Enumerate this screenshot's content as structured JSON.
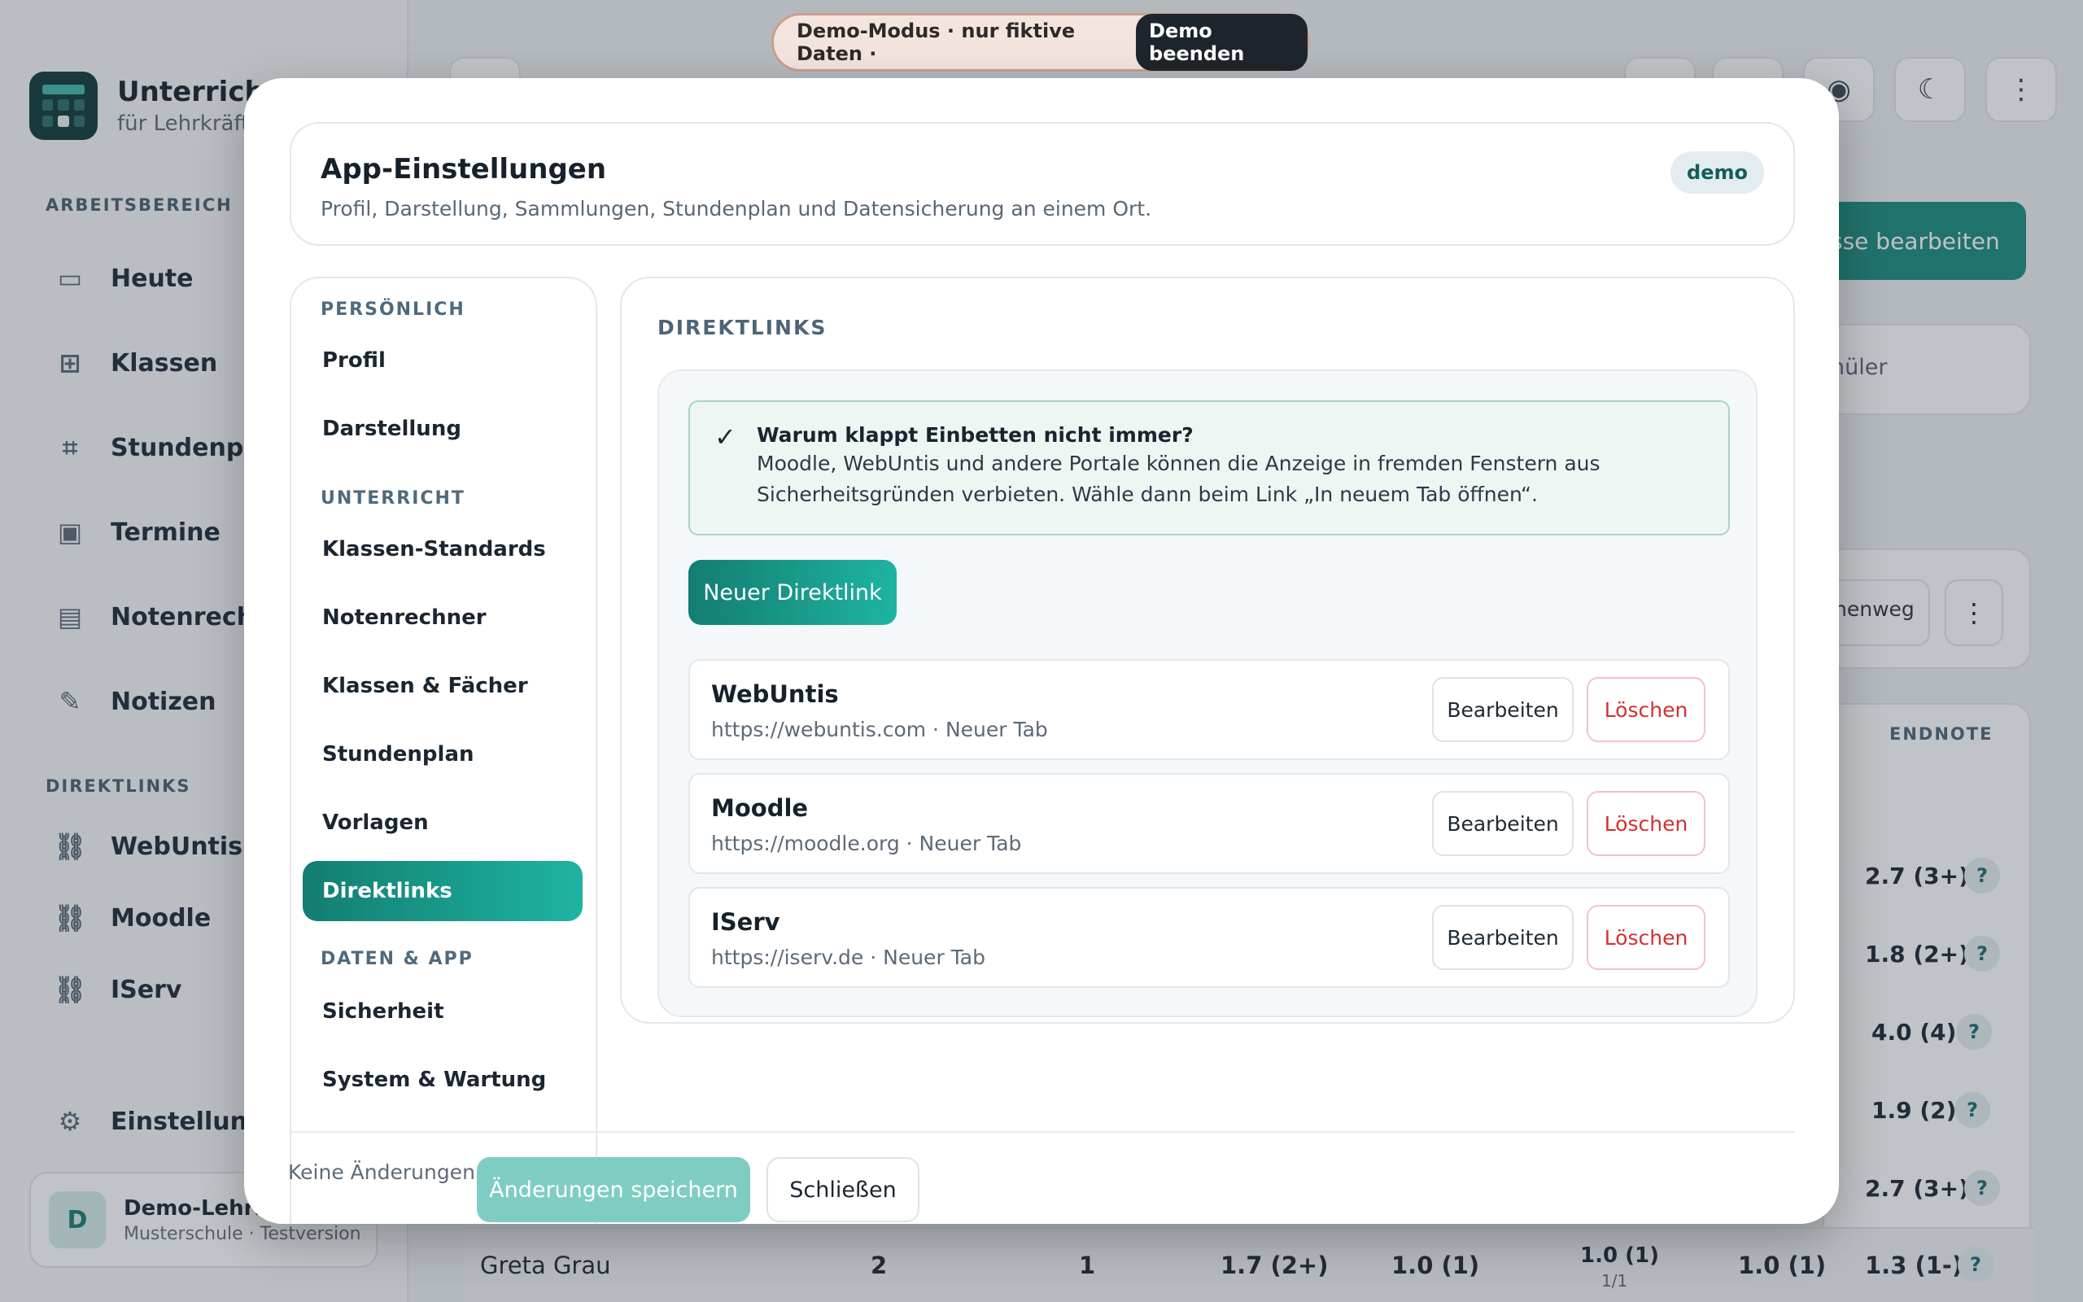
{
  "app": {
    "title": "UnterrichtP",
    "subtitle": "für Lehrkräfte",
    "sidebar": {
      "section_work": "ARBEITSBEREICH",
      "items": [
        {
          "label": "Heute",
          "icon": "calendar-icon"
        },
        {
          "label": "Klassen",
          "icon": "grid-icon"
        },
        {
          "label": "Stundenplan",
          "icon": "table-icon"
        },
        {
          "label": "Termine",
          "icon": "calendar-plus-icon"
        },
        {
          "label": "Notenrechner",
          "icon": "calculator-icon"
        },
        {
          "label": "Notizen",
          "icon": "pen-icon"
        }
      ],
      "section_links": "DIREKTLINKS",
      "links": [
        {
          "label": "WebUntis",
          "icon": "link-icon"
        },
        {
          "label": "Moodle",
          "icon": "link-icon"
        },
        {
          "label": "IServ",
          "icon": "link-icon"
        }
      ],
      "settings_label": "Einstellungen",
      "user": {
        "initial": "D",
        "name": "Demo-Lehrkr",
        "school": "Musterschule · Testversion"
      }
    },
    "main": {
      "edit_class": "sse bearbeiten",
      "students_fragment": "nüler",
      "path_fragment": "henweg",
      "grade_header": "ENDNOTE",
      "grades": [
        "2.7 (3+)",
        "1.8 (2+)",
        "4.0 (4)",
        "1.9 (2)",
        "2.7 (3+)",
        "1.3 (1-)"
      ],
      "last_row": {
        "name": "Greta Grau",
        "c1": "2",
        "c2": "1",
        "c3": "1.7 (2+)",
        "c4": "1.0 (1)",
        "c5": "1.0 (1)",
        "c5_sub": "1/1",
        "c6": "1.0 (1)"
      }
    }
  },
  "demo_banner": {
    "text": "Demo-Modus · nur fiktive Daten ·",
    "button": "Demo beenden"
  },
  "modal": {
    "title": "App-Einstellungen",
    "subtitle": "Profil, Darstellung, Sammlungen, Stundenplan und Datensicherung an einem Ort.",
    "badge": "demo",
    "nav": {
      "sections": [
        "PERSÖNLICH",
        "UNTERRICHT",
        "DATEN & APP"
      ],
      "items": [
        "Profil",
        "Darstellung",
        "Klassen-Standards",
        "Notenrechner",
        "Klassen & Fächer",
        "Stundenplan",
        "Vorlagen",
        "Direktlinks",
        "Sicherheit",
        "System & Wartung"
      ],
      "active": "Direktlinks"
    },
    "content": {
      "section_title": "DIREKTLINKS",
      "notice_title": "Warum klappt Einbetten nicht immer?",
      "notice_line1": "Moodle, WebUntis und andere Portale können die Anzeige in fremden Fenstern aus",
      "notice_line2": "Sicherheitsgründen verbieten. Wähle dann beim Link „In neuem Tab öffnen“.",
      "new_button": "Neuer Direktlink",
      "links": [
        {
          "name": "WebUntis",
          "meta": "https://webuntis.com · Neuer Tab"
        },
        {
          "name": "Moodle",
          "meta": "https://moodle.org · Neuer Tab"
        },
        {
          "name": "IServ",
          "meta": "https://iserv.de · Neuer Tab"
        }
      ],
      "edit_label": "Bearbeiten",
      "delete_label": "Löschen"
    },
    "footer": {
      "status": "Keine Änderungen",
      "save": "Änderungen speichern",
      "close": "Schließen"
    }
  },
  "colors": {
    "accent": "#1a8b7e",
    "accent_light": "#1eb4a1",
    "danger": "#d2302f"
  }
}
